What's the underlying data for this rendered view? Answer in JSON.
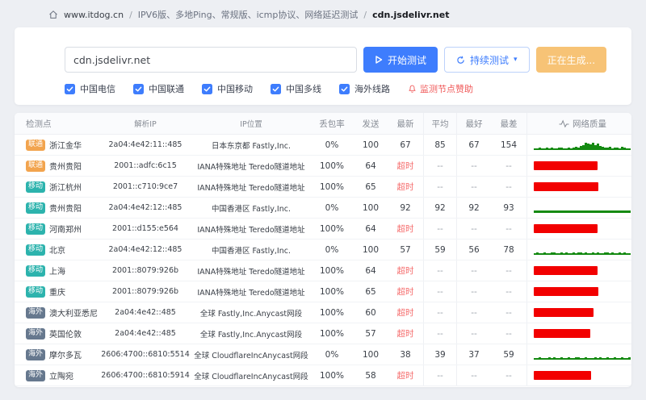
{
  "breadcrumb": {
    "site": "www.itdog.cn",
    "separator": "/",
    "category": "IPV6版、多地Ping、常规版、icmp协议、网络延迟测试",
    "current": "cdn.jsdelivr.net"
  },
  "test_panel": {
    "input_value": "cdn.jsdelivr.net",
    "start_button": "开始测试",
    "continuous_button": "持续测试",
    "generating_button": "正在生成...",
    "checkboxes": [
      {
        "label": "中国电信",
        "checked": true
      },
      {
        "label": "中国联通",
        "checked": true
      },
      {
        "label": "中国移动",
        "checked": true
      },
      {
        "label": "中国多线",
        "checked": true
      },
      {
        "label": "海外线路",
        "checked": true
      }
    ],
    "sponsor_link": "监测节点赞助"
  },
  "table": {
    "headers": [
      "检测点",
      "解析IP",
      "IP位置",
      "丢包率",
      "发送",
      "最新",
      "平均",
      "最好",
      "最差",
      "网络质量"
    ],
    "timeout_label": "超时",
    "rows": [
      {
        "isp": "联通",
        "isp_class": "unicom",
        "node": "浙江金华",
        "ip": "2a04:4e42:11::485",
        "location": "日本东京都 Fastly,Inc.",
        "loss": "0%",
        "sent": "100",
        "latest": "67",
        "timeout": false,
        "avg": "85",
        "best": "67",
        "worst": "154",
        "spark": [
          2,
          2,
          3,
          2,
          2,
          3,
          2,
          3,
          2,
          2,
          3,
          3,
          2,
          2,
          3,
          2,
          3,
          4,
          3,
          5,
          6,
          9,
          8,
          7,
          9,
          6,
          8,
          5,
          4,
          3,
          3,
          4,
          2,
          3,
          3,
          2,
          4,
          3,
          2,
          2
        ]
      },
      {
        "isp": "联通",
        "isp_class": "unicom",
        "node": "贵州贵阳",
        "ip": "2001::adfc:6c15",
        "location": "IANA特殊地址 Teredo隧道地址",
        "loss": "100%",
        "sent": "64",
        "latest": "超时",
        "timeout": true,
        "avg": "--",
        "best": "--",
        "worst": "--",
        "spark": null
      },
      {
        "isp": "移动",
        "isp_class": "mobile",
        "node": "浙江杭州",
        "ip": "2001::c710:9ce7",
        "location": "IANA特殊地址 Teredo隧道地址",
        "loss": "100%",
        "sent": "65",
        "latest": "超时",
        "timeout": true,
        "avg": "--",
        "best": "--",
        "worst": "--",
        "spark": null
      },
      {
        "isp": "移动",
        "isp_class": "mobile",
        "node": "贵州贵阳",
        "ip": "2a04:4e42:12::485",
        "location": "中国香港区 Fastly,Inc.",
        "loss": "0%",
        "sent": "100",
        "latest": "92",
        "timeout": false,
        "avg": "92",
        "best": "92",
        "worst": "93",
        "spark": [
          3,
          3,
          3,
          3,
          3,
          3,
          3,
          3,
          3,
          3,
          3,
          3,
          3,
          3,
          3,
          3,
          3,
          3,
          3,
          3,
          3,
          3,
          3,
          3,
          3,
          3,
          3,
          3,
          3,
          3,
          3,
          3,
          3,
          3,
          3,
          3,
          3,
          3,
          3,
          3
        ]
      },
      {
        "isp": "移动",
        "isp_class": "mobile",
        "node": "河南郑州",
        "ip": "2001::d155:e564",
        "location": "IANA特殊地址 Teredo隧道地址",
        "loss": "100%",
        "sent": "64",
        "latest": "超时",
        "timeout": true,
        "avg": "--",
        "best": "--",
        "worst": "--",
        "spark": null
      },
      {
        "isp": "移动",
        "isp_class": "mobile",
        "node": "北京",
        "ip": "2a04:4e42:12::485",
        "location": "中国香港区 Fastly,Inc.",
        "loss": "0%",
        "sent": "100",
        "latest": "57",
        "timeout": false,
        "avg": "59",
        "best": "56",
        "worst": "78",
        "spark": [
          2,
          3,
          2,
          2,
          3,
          2,
          2,
          3,
          3,
          2,
          2,
          3,
          2,
          3,
          2,
          2,
          3,
          2,
          3,
          3,
          2,
          3,
          2,
          2,
          3,
          2,
          3,
          2,
          2,
          3,
          3,
          2,
          3,
          2,
          2,
          3,
          2,
          3,
          2,
          2
        ]
      },
      {
        "isp": "移动",
        "isp_class": "mobile",
        "node": "上海",
        "ip": "2001::8079:926b",
        "location": "IANA特殊地址 Teredo隧道地址",
        "loss": "100%",
        "sent": "64",
        "latest": "超时",
        "timeout": true,
        "avg": "--",
        "best": "--",
        "worst": "--",
        "spark": null
      },
      {
        "isp": "移动",
        "isp_class": "mobile",
        "node": "重庆",
        "ip": "2001::8079:926b",
        "location": "IANA特殊地址 Teredo隧道地址",
        "loss": "100%",
        "sent": "65",
        "latest": "超时",
        "timeout": true,
        "avg": "--",
        "best": "--",
        "worst": "--",
        "spark": null
      },
      {
        "isp": "海外",
        "isp_class": "overseas",
        "node": "澳大利亚悉尼",
        "ip": "2a04:4e42::485",
        "location": "全球 Fastly,Inc.Anycast网段",
        "loss": "100%",
        "sent": "60",
        "latest": "超时",
        "timeout": true,
        "avg": "--",
        "best": "--",
        "worst": "--",
        "spark": null
      },
      {
        "isp": "海外",
        "isp_class": "overseas",
        "node": "英国伦敦",
        "ip": "2a04:4e42::485",
        "location": "全球 Fastly,Inc.Anycast网段",
        "loss": "100%",
        "sent": "57",
        "latest": "超时",
        "timeout": true,
        "avg": "--",
        "best": "--",
        "worst": "--",
        "spark": null
      },
      {
        "isp": "海外",
        "isp_class": "overseas",
        "node": "摩尔多瓦",
        "ip": "2606:4700::6810:5514",
        "location": "全球 CloudflareIncAnycast网段",
        "loss": "0%",
        "sent": "100",
        "latest": "38",
        "timeout": false,
        "avg": "39",
        "best": "37",
        "worst": "59",
        "spark": [
          2,
          2,
          3,
          2,
          2,
          2,
          3,
          2,
          3,
          2,
          2,
          3,
          2,
          2,
          3,
          2,
          2,
          3,
          3,
          2,
          2,
          3,
          2,
          2,
          2,
          3,
          2,
          3,
          2,
          2,
          3,
          2,
          2,
          3,
          2,
          2,
          3,
          2,
          2,
          3
        ]
      },
      {
        "isp": "海外",
        "isp_class": "overseas",
        "node": "立陶宛",
        "ip": "2606:4700::6810:5914",
        "location": "全球 CloudflareIncAnycast网段",
        "loss": "100%",
        "sent": "58",
        "latest": "超时",
        "timeout": true,
        "avg": "--",
        "best": "--",
        "worst": "--",
        "spark": null
      }
    ]
  },
  "colors": {
    "primary": "#3e7dfd",
    "warn": "#f7c376",
    "timeout_red": "#f56c6c",
    "bar_red": "#f20000",
    "spark_green": "#158a12",
    "badge_unicom": "#f2a44e",
    "badge_mobile": "#2cb3ad",
    "badge_overseas": "#66788e",
    "link_red": "#f05a5a"
  }
}
